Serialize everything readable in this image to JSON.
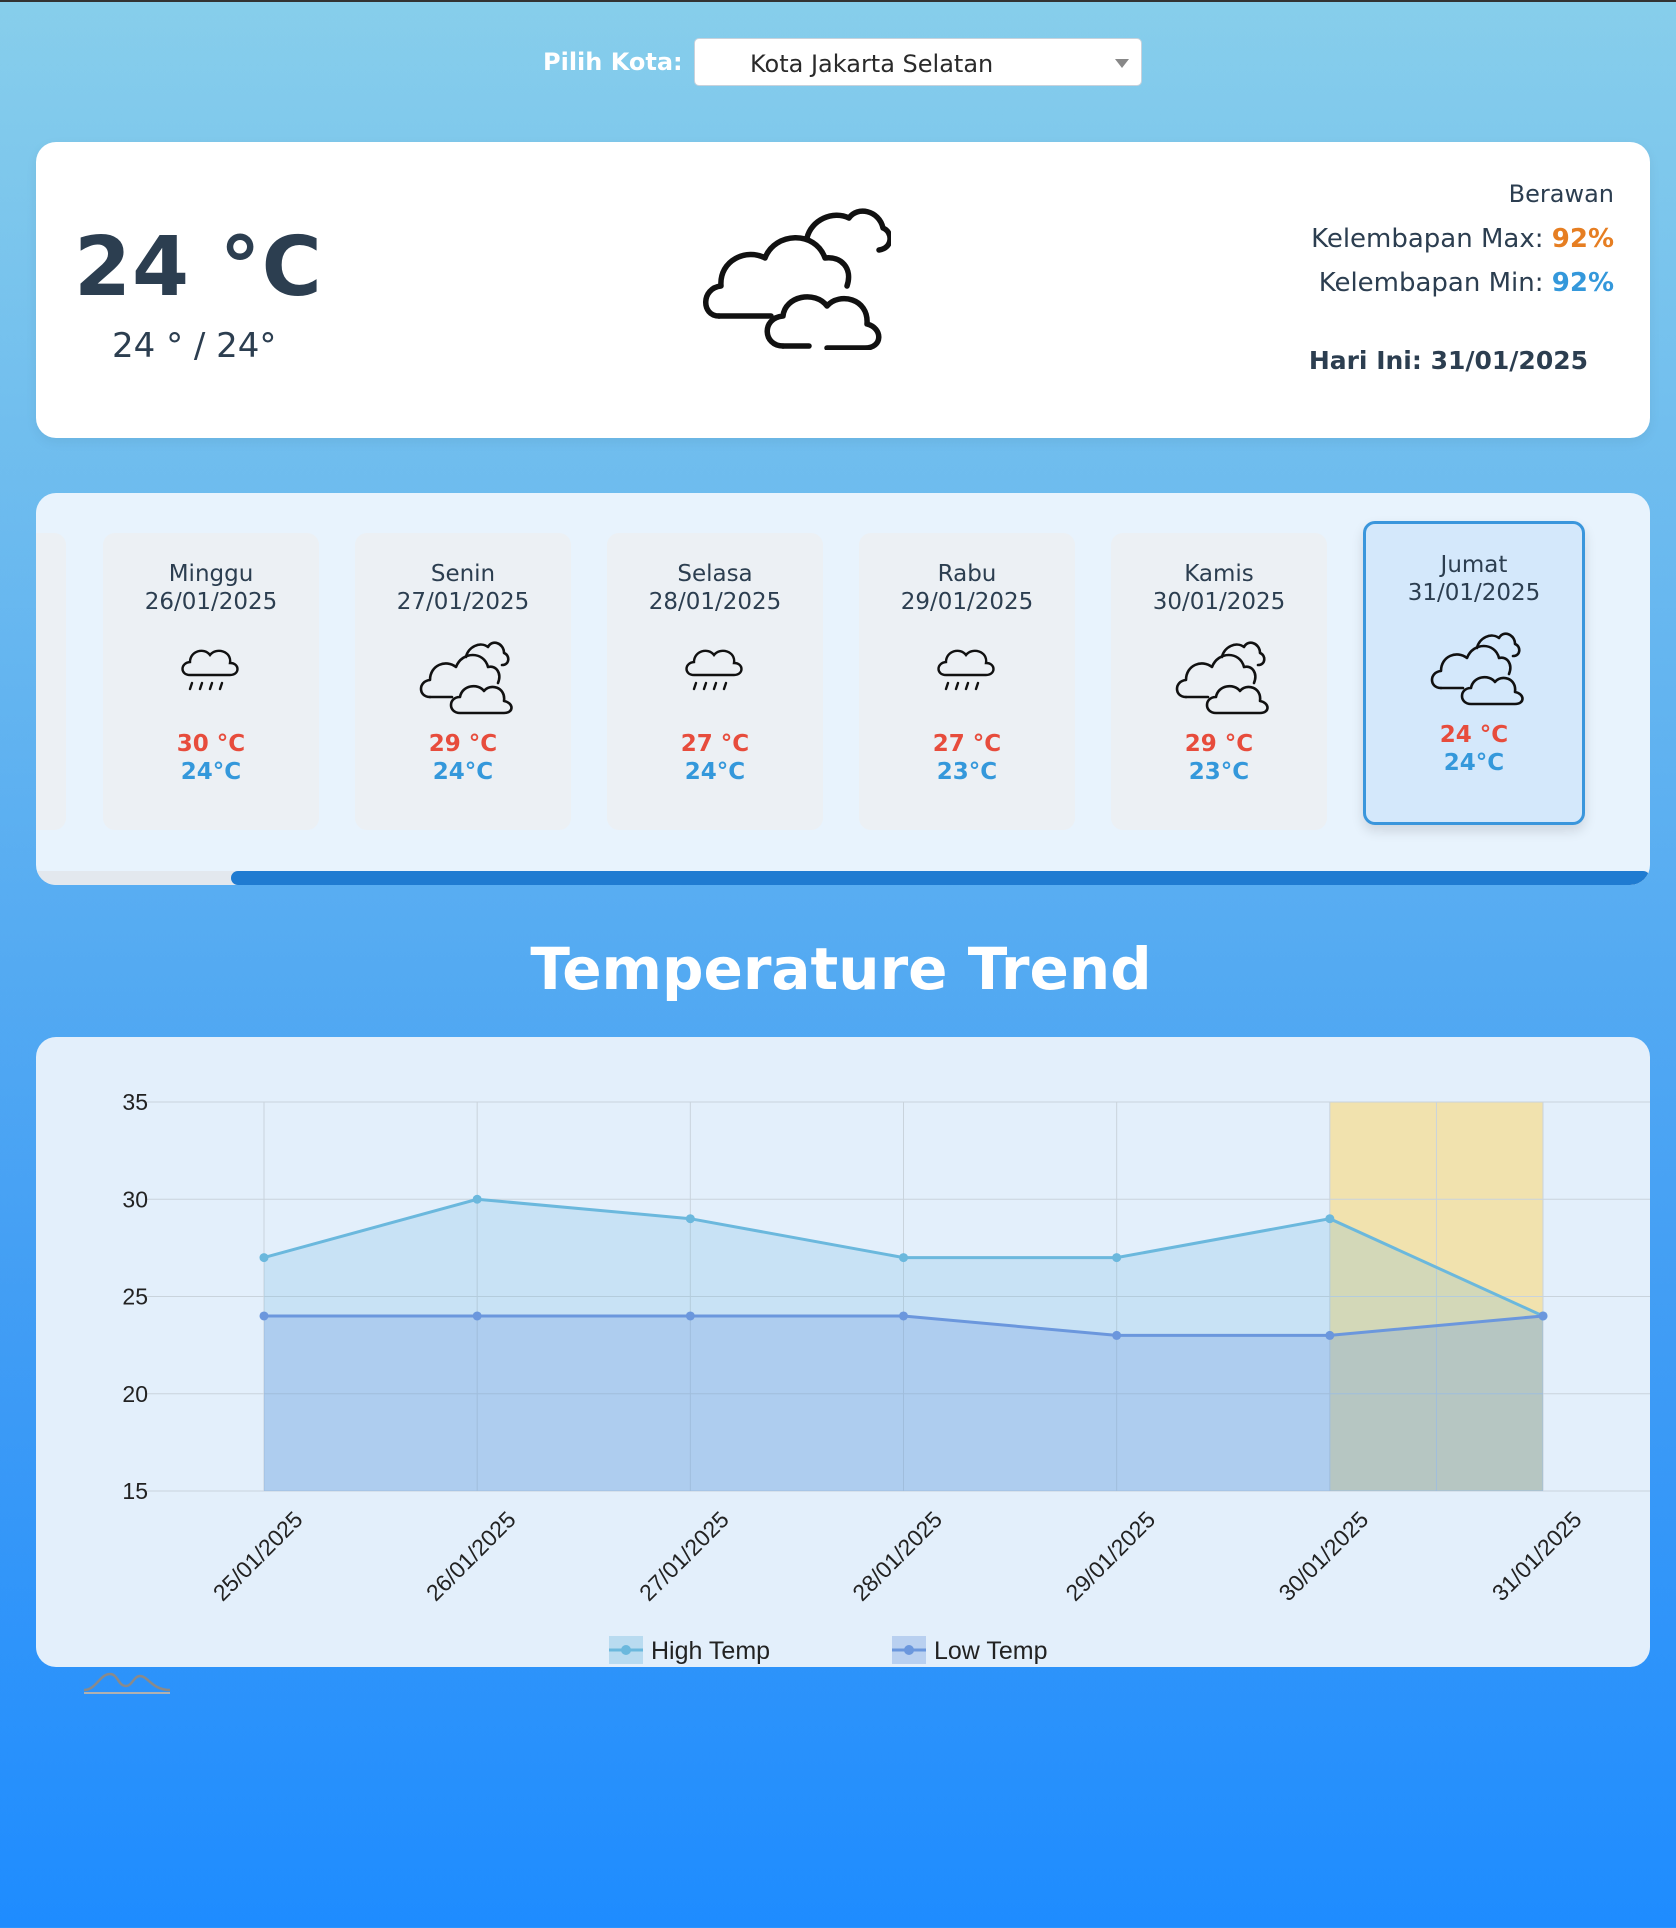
{
  "city": {
    "label": "Pilih Kota:",
    "selected": "Kota Jakarta Selatan"
  },
  "current": {
    "temp": "24 °C",
    "range": "24 ° / 24°",
    "condition": "Berawan",
    "humidity_max_label": "Kelembapan Max:",
    "humidity_max": "92%",
    "humidity_min_label": "Kelembapan Min:",
    "humidity_min": "92%",
    "today": "Hari Ini: 31/01/2025",
    "icon": "cloudy-icon"
  },
  "forecast": [
    {
      "day": "Minggu",
      "date": "26/01/2025",
      "hi": "30 °C",
      "lo": "24°C",
      "icon": "rain-icon"
    },
    {
      "day": "Senin",
      "date": "27/01/2025",
      "hi": "29 °C",
      "lo": "24°C",
      "icon": "cloudy-icon"
    },
    {
      "day": "Selasa",
      "date": "28/01/2025",
      "hi": "27 °C",
      "lo": "24°C",
      "icon": "rain-icon"
    },
    {
      "day": "Rabu",
      "date": "29/01/2025",
      "hi": "27 °C",
      "lo": "23°C",
      "icon": "rain-icon"
    },
    {
      "day": "Kamis",
      "date": "30/01/2025",
      "hi": "29 °C",
      "lo": "23°C",
      "icon": "cloudy-icon"
    },
    {
      "day": "Jumat",
      "date": "31/01/2025",
      "hi": "24 °C",
      "lo": "24°C",
      "icon": "cloudy-icon",
      "active": true
    }
  ],
  "trend_title": "Temperature Trend",
  "chart_data": {
    "type": "line",
    "x": [
      "25/01/2025",
      "26/01/2025",
      "27/01/2025",
      "28/01/2025",
      "29/01/2025",
      "30/01/2025",
      "31/01/2025"
    ],
    "series": [
      {
        "name": "High Temp",
        "values": [
          27,
          30,
          29,
          27,
          27,
          29,
          24
        ],
        "color": "#6bb8dd"
      },
      {
        "name": "Low Temp",
        "values": [
          24,
          24,
          24,
          24,
          23,
          23,
          24
        ],
        "color": "#6b97dd"
      }
    ],
    "ylim": [
      15,
      35
    ],
    "yticks": [
      "15",
      "20",
      "25",
      "30",
      "35"
    ],
    "highlight": {
      "from": "30/01/2025",
      "to": "31/01/2025",
      "color": "#f3dfa0"
    },
    "grid": true,
    "legend": "bottom-center"
  },
  "colors": {
    "hi": "#e74c3c",
    "lo": "#3498db",
    "accent": "#1f7bd1"
  }
}
